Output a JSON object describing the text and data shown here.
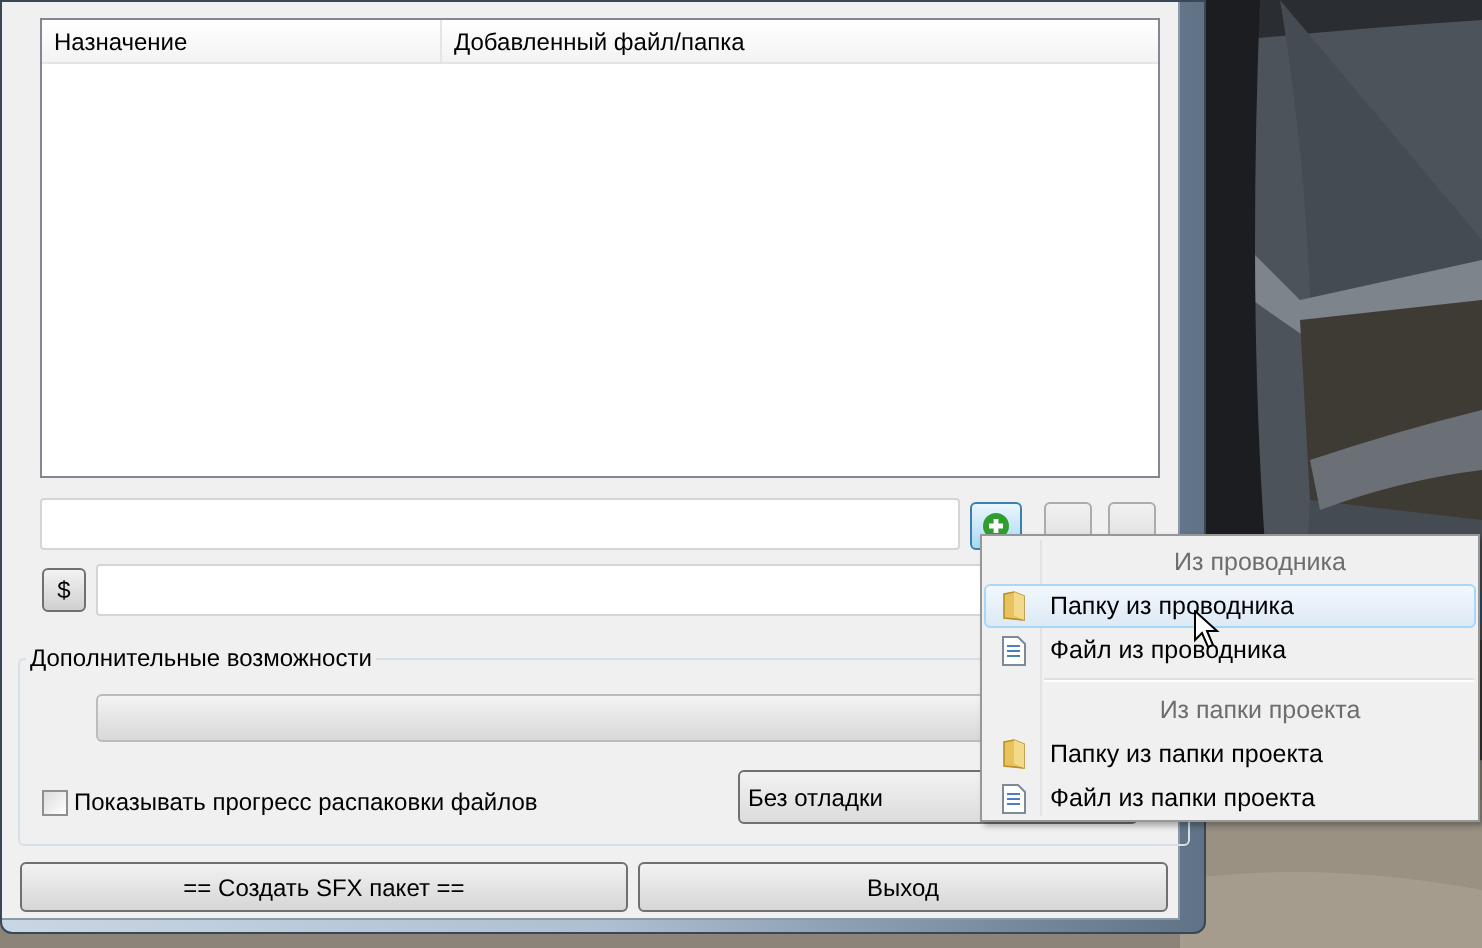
{
  "list": {
    "columns": [
      "Назначение",
      "Добавленный файл/папка"
    ]
  },
  "variable_button": {
    "label": "$"
  },
  "extra_group": {
    "title": "Дополнительные возможности",
    "show_progress": {
      "label": "Показывать прогресс распаковки файлов",
      "checked": false
    },
    "debug_select": {
      "value": "Без отладки"
    }
  },
  "buttons": [
    "== Создать SFX пакет ==",
    "Выход"
  ],
  "context_menu": {
    "groups": [
      {
        "header": "Из проводника",
        "items": [
          {
            "label": "Папку из проводника",
            "kind": "folder",
            "selected": true
          },
          {
            "label": "Файл из проводника",
            "kind": "file",
            "selected": false
          }
        ]
      },
      {
        "header": "Из папки проекта",
        "items": [
          {
            "label": "Папку из папки проекта",
            "kind": "folder",
            "selected": false
          },
          {
            "label": "Файл из папки проекта",
            "kind": "file",
            "selected": false
          }
        ]
      }
    ]
  }
}
